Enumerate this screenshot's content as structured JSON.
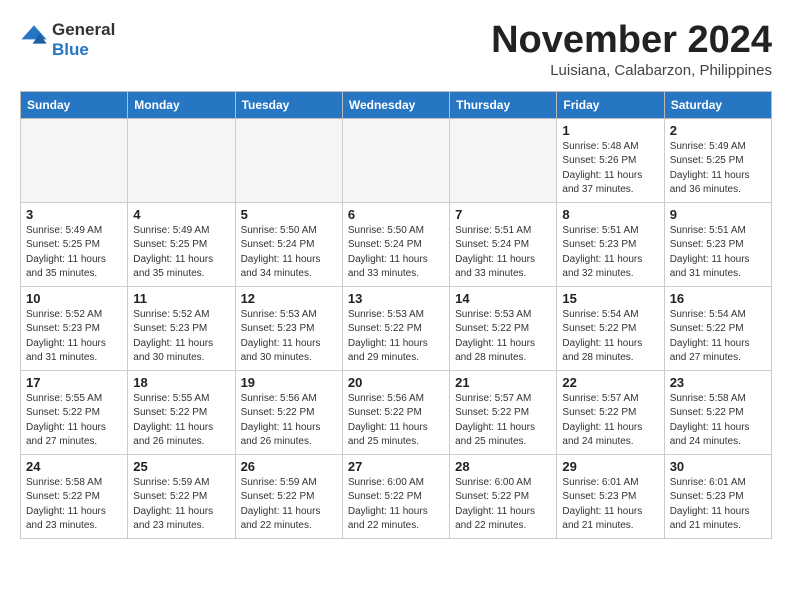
{
  "header": {
    "logo_general": "General",
    "logo_blue": "Blue",
    "month_title": "November 2024",
    "location": "Luisiana, Calabarzon, Philippines"
  },
  "weekdays": [
    "Sunday",
    "Monday",
    "Tuesday",
    "Wednesday",
    "Thursday",
    "Friday",
    "Saturday"
  ],
  "weeks": [
    [
      {
        "day": "",
        "info": ""
      },
      {
        "day": "",
        "info": ""
      },
      {
        "day": "",
        "info": ""
      },
      {
        "day": "",
        "info": ""
      },
      {
        "day": "",
        "info": ""
      },
      {
        "day": "1",
        "info": "Sunrise: 5:48 AM\nSunset: 5:26 PM\nDaylight: 11 hours\nand 37 minutes."
      },
      {
        "day": "2",
        "info": "Sunrise: 5:49 AM\nSunset: 5:25 PM\nDaylight: 11 hours\nand 36 minutes."
      }
    ],
    [
      {
        "day": "3",
        "info": "Sunrise: 5:49 AM\nSunset: 5:25 PM\nDaylight: 11 hours\nand 35 minutes."
      },
      {
        "day": "4",
        "info": "Sunrise: 5:49 AM\nSunset: 5:25 PM\nDaylight: 11 hours\nand 35 minutes."
      },
      {
        "day": "5",
        "info": "Sunrise: 5:50 AM\nSunset: 5:24 PM\nDaylight: 11 hours\nand 34 minutes."
      },
      {
        "day": "6",
        "info": "Sunrise: 5:50 AM\nSunset: 5:24 PM\nDaylight: 11 hours\nand 33 minutes."
      },
      {
        "day": "7",
        "info": "Sunrise: 5:51 AM\nSunset: 5:24 PM\nDaylight: 11 hours\nand 33 minutes."
      },
      {
        "day": "8",
        "info": "Sunrise: 5:51 AM\nSunset: 5:23 PM\nDaylight: 11 hours\nand 32 minutes."
      },
      {
        "day": "9",
        "info": "Sunrise: 5:51 AM\nSunset: 5:23 PM\nDaylight: 11 hours\nand 31 minutes."
      }
    ],
    [
      {
        "day": "10",
        "info": "Sunrise: 5:52 AM\nSunset: 5:23 PM\nDaylight: 11 hours\nand 31 minutes."
      },
      {
        "day": "11",
        "info": "Sunrise: 5:52 AM\nSunset: 5:23 PM\nDaylight: 11 hours\nand 30 minutes."
      },
      {
        "day": "12",
        "info": "Sunrise: 5:53 AM\nSunset: 5:23 PM\nDaylight: 11 hours\nand 30 minutes."
      },
      {
        "day": "13",
        "info": "Sunrise: 5:53 AM\nSunset: 5:22 PM\nDaylight: 11 hours\nand 29 minutes."
      },
      {
        "day": "14",
        "info": "Sunrise: 5:53 AM\nSunset: 5:22 PM\nDaylight: 11 hours\nand 28 minutes."
      },
      {
        "day": "15",
        "info": "Sunrise: 5:54 AM\nSunset: 5:22 PM\nDaylight: 11 hours\nand 28 minutes."
      },
      {
        "day": "16",
        "info": "Sunrise: 5:54 AM\nSunset: 5:22 PM\nDaylight: 11 hours\nand 27 minutes."
      }
    ],
    [
      {
        "day": "17",
        "info": "Sunrise: 5:55 AM\nSunset: 5:22 PM\nDaylight: 11 hours\nand 27 minutes."
      },
      {
        "day": "18",
        "info": "Sunrise: 5:55 AM\nSunset: 5:22 PM\nDaylight: 11 hours\nand 26 minutes."
      },
      {
        "day": "19",
        "info": "Sunrise: 5:56 AM\nSunset: 5:22 PM\nDaylight: 11 hours\nand 26 minutes."
      },
      {
        "day": "20",
        "info": "Sunrise: 5:56 AM\nSunset: 5:22 PM\nDaylight: 11 hours\nand 25 minutes."
      },
      {
        "day": "21",
        "info": "Sunrise: 5:57 AM\nSunset: 5:22 PM\nDaylight: 11 hours\nand 25 minutes."
      },
      {
        "day": "22",
        "info": "Sunrise: 5:57 AM\nSunset: 5:22 PM\nDaylight: 11 hours\nand 24 minutes."
      },
      {
        "day": "23",
        "info": "Sunrise: 5:58 AM\nSunset: 5:22 PM\nDaylight: 11 hours\nand 24 minutes."
      }
    ],
    [
      {
        "day": "24",
        "info": "Sunrise: 5:58 AM\nSunset: 5:22 PM\nDaylight: 11 hours\nand 23 minutes."
      },
      {
        "day": "25",
        "info": "Sunrise: 5:59 AM\nSunset: 5:22 PM\nDaylight: 11 hours\nand 23 minutes."
      },
      {
        "day": "26",
        "info": "Sunrise: 5:59 AM\nSunset: 5:22 PM\nDaylight: 11 hours\nand 22 minutes."
      },
      {
        "day": "27",
        "info": "Sunrise: 6:00 AM\nSunset: 5:22 PM\nDaylight: 11 hours\nand 22 minutes."
      },
      {
        "day": "28",
        "info": "Sunrise: 6:00 AM\nSunset: 5:22 PM\nDaylight: 11 hours\nand 22 minutes."
      },
      {
        "day": "29",
        "info": "Sunrise: 6:01 AM\nSunset: 5:23 PM\nDaylight: 11 hours\nand 21 minutes."
      },
      {
        "day": "30",
        "info": "Sunrise: 6:01 AM\nSunset: 5:23 PM\nDaylight: 11 hours\nand 21 minutes."
      }
    ]
  ]
}
